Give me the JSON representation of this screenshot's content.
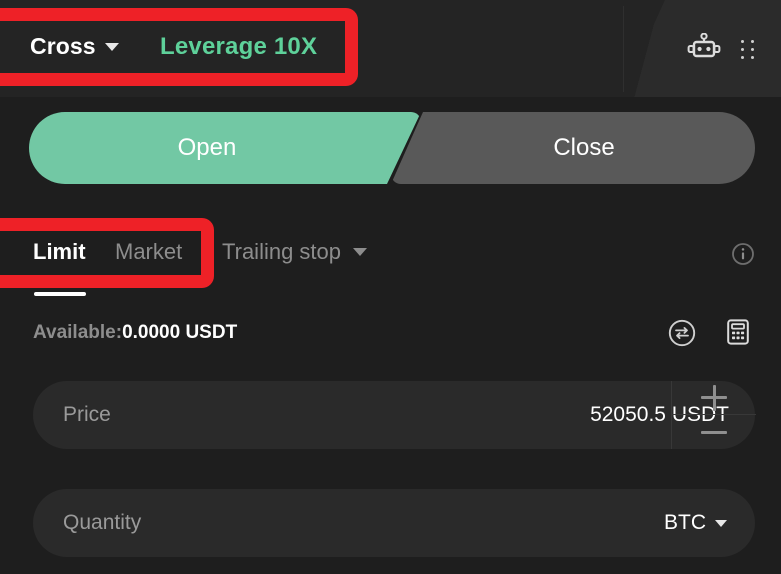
{
  "header": {
    "margin_mode": "Cross",
    "margin_mode_caret_icon": "chevron-down-icon",
    "leverage": "Leverage 10X",
    "bot_icon": "robot-icon",
    "drag_handle_icon": "drag-handle-icon"
  },
  "side_tabs": {
    "open_label": "Open",
    "close_label": "Close",
    "active": "Open",
    "open_color": "#72c8a4",
    "close_color": "#595959"
  },
  "order_types": {
    "limit_label": "Limit",
    "market_label": "Market",
    "trailing_stop_label": "Trailing stop",
    "trailing_caret_icon": "chevron-down-icon",
    "active": "Limit",
    "info_icon": "info-circle-icon"
  },
  "balance": {
    "label": "Available:",
    "value": "0.0000 USDT",
    "swap_icon": "transfer-swap-icon",
    "calculator_icon": "calculator-icon"
  },
  "price_field": {
    "label": "Price",
    "value": "52050.5 USDT",
    "increment_icon": "plus-icon",
    "decrement_icon": "minus-icon"
  },
  "quantity_field": {
    "placeholder": "Quantity",
    "unit": "BTC",
    "unit_caret_icon": "chevron-down-icon"
  },
  "annotations": {
    "highlight_color": "#ee2127"
  },
  "theme": {
    "page_bg": "#1e1e1e",
    "header_bg": "#242424",
    "field_bg": "#2a2a2a",
    "accent_green": "#5ed19a",
    "text_primary": "#ffffff",
    "text_muted": "#8d8d8d"
  }
}
